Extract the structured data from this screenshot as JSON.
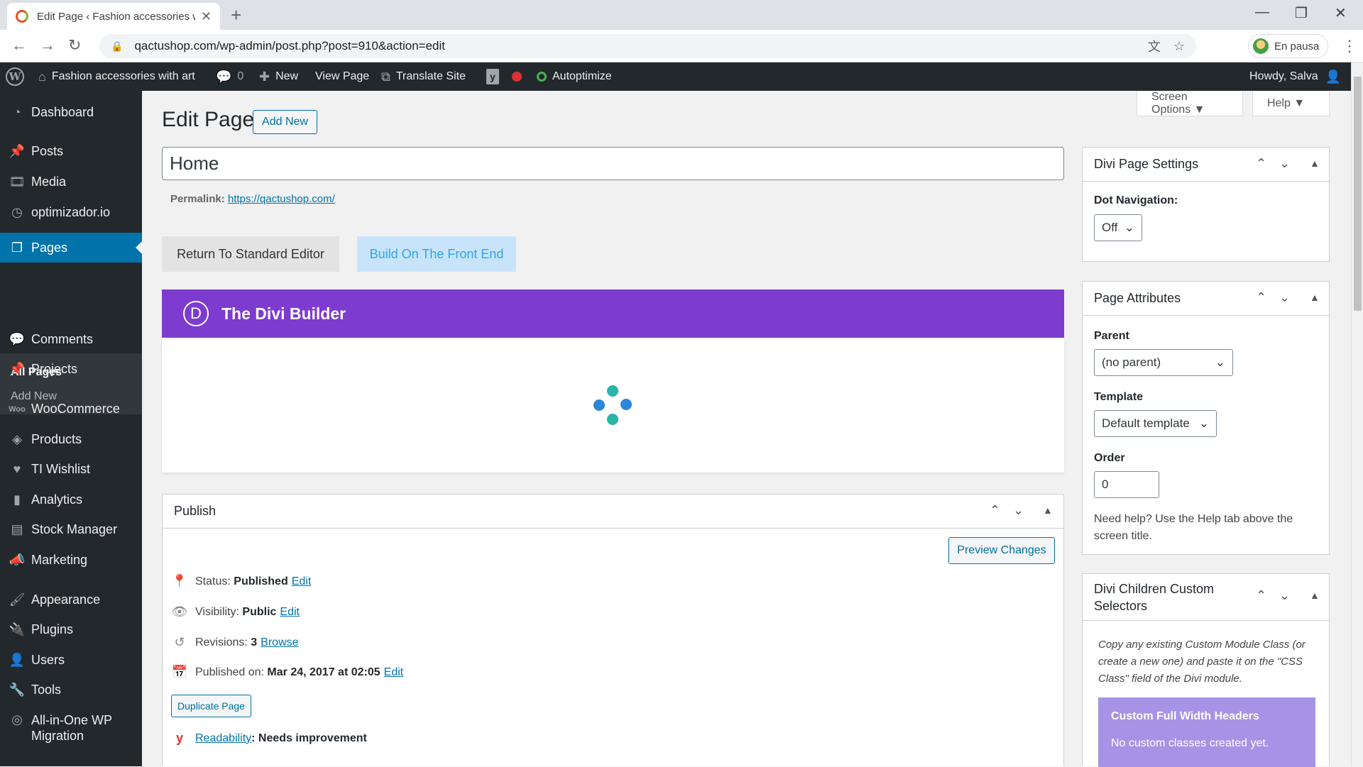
{
  "browser": {
    "tab_title": "Edit Page ‹ Fashion accessories w",
    "url": "qactushop.com/wp-admin/post.php?post=910&action=edit",
    "profile_label": "En pausa"
  },
  "adminbar": {
    "site_name": "Fashion accessories with art",
    "comments_count": "0",
    "new_label": "New",
    "view_page": "View Page",
    "translate_site": "Translate Site",
    "autoptimize": "Autoptimize",
    "howdy": "Howdy, Salva"
  },
  "sidebar": {
    "items": [
      {
        "label": "Dashboard",
        "icon": "dashboard-icon"
      },
      {
        "label": "Posts",
        "icon": "pin-icon"
      },
      {
        "label": "Media",
        "icon": "media-icon"
      },
      {
        "label": "optimizador.io",
        "icon": "gauge-icon"
      },
      {
        "label": "Pages",
        "icon": "page-icon"
      },
      {
        "label": "Comments",
        "icon": "comment-icon"
      },
      {
        "label": "Projects",
        "icon": "pin-icon"
      },
      {
        "label": "WooCommerce",
        "icon": "woo-icon"
      },
      {
        "label": "Products",
        "icon": "box-icon"
      },
      {
        "label": "TI Wishlist",
        "icon": "heart-icon"
      },
      {
        "label": "Analytics",
        "icon": "bar-chart-icon"
      },
      {
        "label": "Stock Manager",
        "icon": "book-icon"
      },
      {
        "label": "Marketing",
        "icon": "megaphone-icon"
      },
      {
        "label": "Appearance",
        "icon": "brush-icon"
      },
      {
        "label": "Plugins",
        "icon": "plug-icon"
      },
      {
        "label": "Users",
        "icon": "user-icon"
      },
      {
        "label": "Tools",
        "icon": "wrench-icon"
      },
      {
        "label": "All-in-One WP Migration",
        "icon": "migration-icon"
      }
    ],
    "submenu": [
      "All Pages",
      "Add New"
    ]
  },
  "header": {
    "screen_options": "Screen Options ▼",
    "help": "Help ▼",
    "title": "Edit Page",
    "add_new": "Add New"
  },
  "editor": {
    "post_title": "Home",
    "permalink_label": "Permalink:",
    "permalink_url": "https://qactushop.com/",
    "return_standard": "Return To Standard Editor",
    "build_front": "Build On The Front End",
    "divi_title": "The Divi Builder",
    "divi_logo": "D"
  },
  "publish": {
    "title": "Publish",
    "preview": "Preview Changes",
    "status_label": "Status:",
    "status_value": "Published",
    "visibility_label": "Visibility:",
    "visibility_value": "Public",
    "revisions_label": "Revisions:",
    "revisions_value": "3",
    "browse": "Browse",
    "published_label": "Published on:",
    "published_value": "Mar 24, 2017 at 02:05",
    "edit": "Edit",
    "duplicate": "Duplicate Page",
    "readability_link": "Readability",
    "readability_value": ": Needs improvement"
  },
  "divi_settings": {
    "title": "Divi Page Settings",
    "dot_nav_label": "Dot Navigation:",
    "dot_nav_value": "Off"
  },
  "page_attributes": {
    "title": "Page Attributes",
    "parent_label": "Parent",
    "parent_value": "(no parent)",
    "template_label": "Template",
    "template_value": "Default template",
    "order_label": "Order",
    "order_value": "0",
    "help_text": "Need help? Use the Help tab above the screen title."
  },
  "divi_children": {
    "title": "Divi Children Custom Selectors",
    "description": "Copy any existing Custom Module Class (or create a new one) and paste it on the \"CSS Class\" field of the Divi module.",
    "card_title": "Custom Full Width Headers",
    "card_text": "No custom classes created yet."
  },
  "colors": {
    "wp_blue": "#0073aa",
    "divi_purple": "#7e3bd0",
    "admin_dark": "#23282d"
  }
}
